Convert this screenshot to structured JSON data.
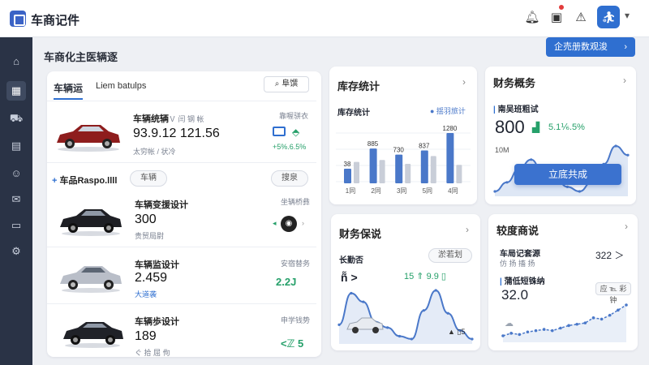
{
  "app": {
    "title": "车商记件"
  },
  "page": {
    "title": "车商化主医辆逐",
    "primary_button": "企売册数观浚"
  },
  "vehicles": {
    "tabs": [
      "车辆运",
      "Liem batulps"
    ],
    "search_label": "阜馔",
    "featured": {
      "name": "车辆统辆",
      "sub_right": "Ｖ 闫 钢 帐",
      "value": "93.9.12 121.56",
      "meta": "太穷帐 / 状冷",
      "right_label": "靠喔骈衣",
      "change": "+5%.6.5%"
    },
    "section_title": "车品Raspo.llll",
    "section_pill": "车辆",
    "section_pill2": "搜泉",
    "items": [
      {
        "name": "车辆变援设计",
        "value": "300",
        "meta": "贵贸局尉",
        "right_label": "坐辆桥彝",
        "right_value": ""
      },
      {
        "name": "车辆监设计",
        "value": "2.459",
        "meta": "大道袭",
        "right_label": "安宿替务",
        "right_value": "2.2J"
      },
      {
        "name": "车辆歩设计",
        "value": "189",
        "meta": "ぐ 拾 屈 佝",
        "right_label": "申学钱势",
        "right_value": "<ℤ 5"
      }
    ]
  },
  "inventory": {
    "title": "库存统计",
    "subtitle": "库存统计",
    "legend": "● 揺羽旅计"
  },
  "finance_overview": {
    "title": "财务概务",
    "subtitle": "南吴班粗试",
    "value": "800",
    "change": "5.1⅙.5%",
    "y_label": "10M",
    "overlay_button": "立底共成"
  },
  "finance_talk": {
    "title": "财务保说",
    "label": "长勤否",
    "pill": "淤若划",
    "kpi": "ñ̃ >",
    "change": "15 ⇑ 9.9 ▯",
    "footer_text": "▲ ▯5"
  },
  "progress_talk": {
    "title": "较度商说",
    "row1_label": "车局记套源",
    "row1_sub": "仿 扬 搐 扬",
    "row1_value": "322 ＞",
    "row2_label": "蒲低短铢纳",
    "row2_pill": "应 ℡ 彩 钟",
    "row2_value": "32.0"
  },
  "chart_data": [
    {
      "type": "bar",
      "title": "库存统计",
      "categories": [
        "1同",
        "2同",
        "3同",
        "5同",
        "4同"
      ],
      "series": [
        {
          "values": [
            36,
            885,
            730,
            837,
            1280
          ]
        },
        {
          "values": [
            22,
            24,
            20,
            28,
            19
          ]
        }
      ],
      "data_labels": [
        "38",
        "885",
        "730",
        "837",
        "1280"
      ],
      "colors": [
        "#4a78c9",
        "#c9ced8"
      ]
    },
    {
      "type": "area",
      "title": "财务概务",
      "ylabel": "10M",
      "values": [
        10,
        14,
        20,
        24,
        18,
        16,
        12,
        10,
        14,
        22,
        30,
        26
      ]
    },
    {
      "type": "area",
      "title": "财务保说",
      "values": [
        20,
        42,
        36,
        22,
        18,
        12,
        10,
        30,
        44,
        28,
        16,
        10
      ]
    },
    {
      "type": "line",
      "title": "较度商说",
      "values": [
        4,
        6,
        5,
        7,
        8,
        9,
        8,
        10,
        12,
        13,
        14,
        18,
        17,
        20,
        24,
        28
      ]
    }
  ]
}
